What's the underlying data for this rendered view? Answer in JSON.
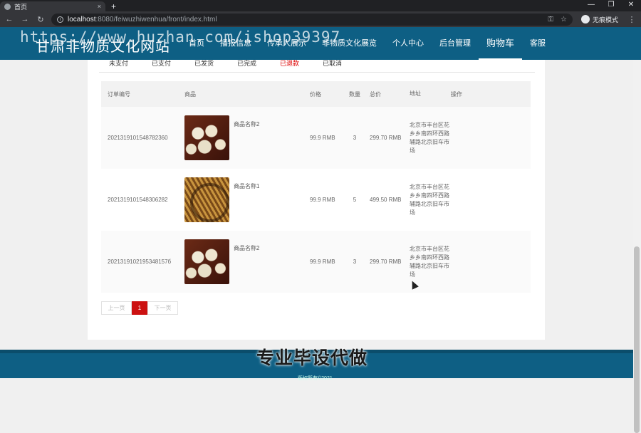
{
  "browser": {
    "tab_title": "首页",
    "tab_close": "×",
    "new_tab": "+",
    "url_host": "localhost",
    "url_path": ":8080/feiwuzhiwenhua/front/index.html",
    "incognito_label": "无痕模式",
    "win_min": "—",
    "win_max": "❐",
    "win_close": "✕"
  },
  "header": {
    "logo": "甘肃非物质文化网站",
    "watermark": "https://www.huzhan.com/ishop39397",
    "nav": [
      "首页",
      "播报信息",
      "传承人展示",
      "非物质文化展览",
      "个人中心",
      "后台管理",
      "购物车",
      "客服"
    ],
    "active_nav": "购物车"
  },
  "status_tabs": [
    "未支付",
    "已支付",
    "已发货",
    "已完成",
    "已退款",
    "已取消"
  ],
  "active_status": "已退款",
  "table": {
    "headers": {
      "order_id": "订单编号",
      "goods": "商品",
      "price": "价格",
      "qty": "数量",
      "total": "总价",
      "address": "地址",
      "action": "操作"
    },
    "rows": [
      {
        "order_id": "2021319101548782360",
        "goods_name": "商品名称2",
        "price": "99.9 RMB",
        "qty": "3",
        "total": "299.70 RMB",
        "address": "北京市丰台区花乡乡南四环西路辅路北京旧车市场",
        "image": "beads"
      },
      {
        "order_id": "2021319101548306282",
        "goods_name": "商品名称1",
        "price": "99.9 RMB",
        "qty": "5",
        "total": "499.50 RMB",
        "address": "北京市丰台区花乡乡南四环西路辅路北京旧车市场",
        "image": "basket"
      },
      {
        "order_id": "2021319102195348157б",
        "goods_name": "商品名称2",
        "price": "99.9 RMB",
        "qty": "3",
        "total": "299.70 RMB",
        "address": "北京市丰台区花乡乡南四环西路辅路北京旧车市场",
        "image": "beads"
      }
    ]
  },
  "pager": {
    "prev": "上一页",
    "current": "1",
    "next": "下一页"
  },
  "ad_text": "专业毕设代做",
  "footer_text": "版权所有©2021",
  "colors": {
    "brand": "#0e5f84",
    "accent": "#cc1111"
  }
}
